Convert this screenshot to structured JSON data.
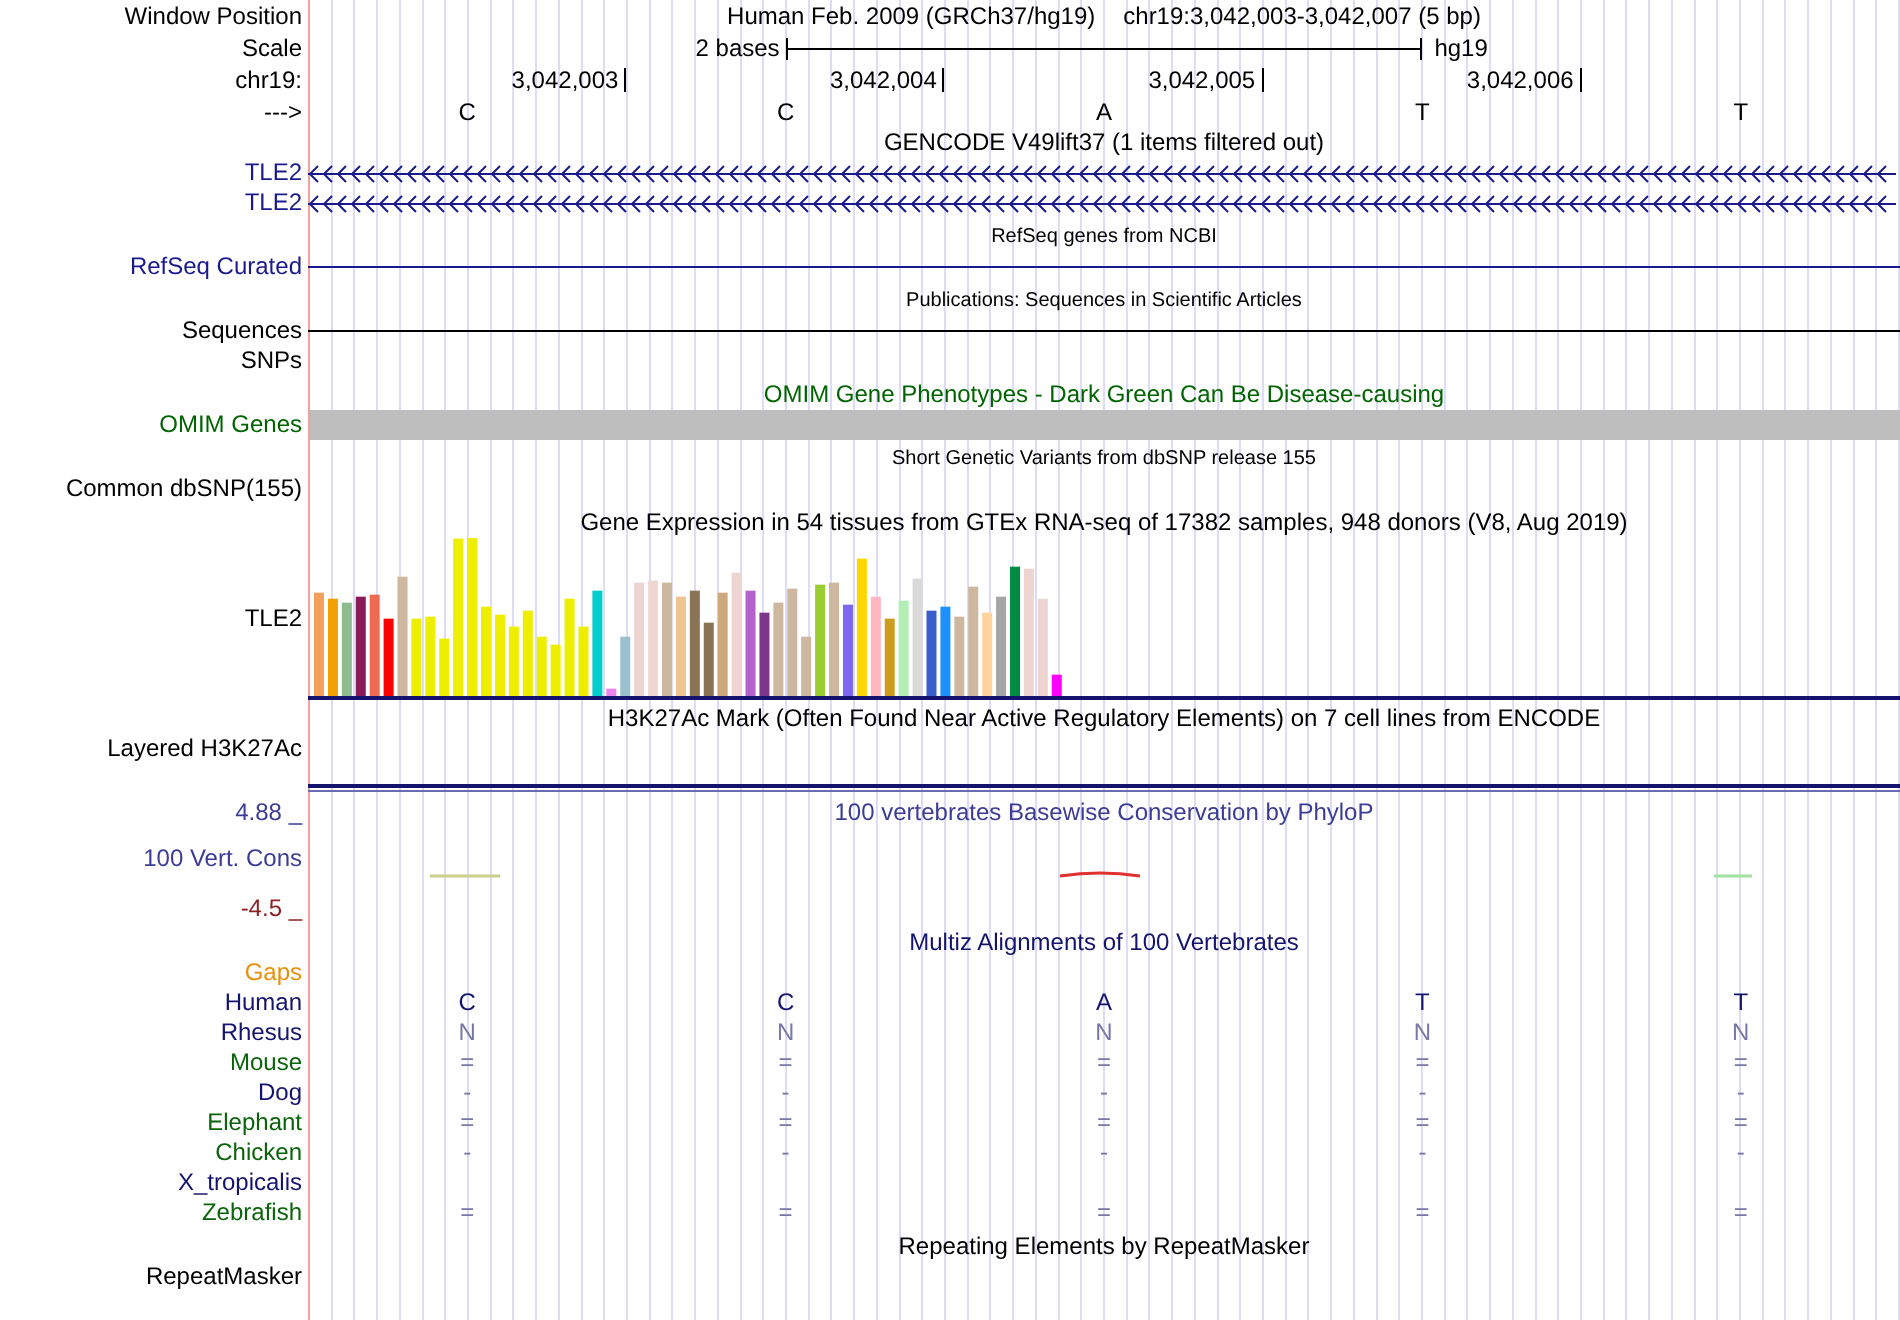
{
  "header": {
    "position_label": "Window Position",
    "assembly": "Human Feb. 2009 (GRCh37/hg19)",
    "position": "chr19:3,042,003-3,042,007 (5 bp)",
    "scale_label": "Scale",
    "scale_text": "2 bases",
    "scale_db": "hg19",
    "chrom_label": "chr19:",
    "ruler": [
      "3,042,003",
      "3,042,004",
      "3,042,005",
      "3,042,006"
    ],
    "strand_label": "--->",
    "bases": [
      "C",
      "C",
      "A",
      "T",
      "T"
    ]
  },
  "tracks": [
    {
      "kind": "major",
      "title": {
        "text": "GENCODE V49lift37 (1 items filtered out)",
        "color": "#000000"
      },
      "rows": [
        {
          "kind": "arrows",
          "label": "TLE2",
          "color": "#1a1a8c"
        },
        {
          "kind": "arrows",
          "label": "TLE2",
          "color": "#1a1a8c"
        }
      ]
    },
    {
      "kind": "minor",
      "title": {
        "text": "RefSeq genes from NCBI",
        "color": "#000000"
      },
      "rows": [
        {
          "kind": "line",
          "label": "RefSeq Curated",
          "color": "#1a1a8c"
        }
      ]
    },
    {
      "kind": "minor",
      "title": {
        "text": "Publications: Sequences in Scientific Articles",
        "color": "#000000"
      },
      "rows": [
        {
          "kind": "line",
          "label": "Sequences",
          "color": "#000000"
        },
        {
          "kind": "empty",
          "label": "SNPs",
          "color": "#000000"
        }
      ]
    },
    {
      "kind": "major",
      "title": {
        "text": "OMIM Gene Phenotypes - Dark Green Can Be Disease-causing",
        "color": "#006400"
      },
      "rows": [
        {
          "kind": "block",
          "label": "OMIM Genes",
          "color": "#006400"
        }
      ]
    },
    {
      "kind": "minor",
      "title": {
        "text": "Short Genetic Variants from dbSNP release 155",
        "color": "#000000"
      },
      "rows": [
        {
          "kind": "empty",
          "label": "Common dbSNP(155)",
          "color": "#000000"
        }
      ]
    },
    {
      "kind": "major",
      "title": {
        "text": "Gene Expression in 54 tissues from GTEx RNA-seq of 17382 samples, 948 donors (V8, Aug 2019)",
        "color": "#000000"
      },
      "rows": [
        {
          "kind": "expression",
          "label": "TLE2",
          "color": "#000000"
        }
      ]
    },
    {
      "kind": "major",
      "title": {
        "text": "H3K27Ac Mark (Often Found Near Active Regulatory Elements) on 7 cell lines from ENCODE",
        "color": "#000000"
      },
      "rows": [
        {
          "kind": "layered",
          "label": "Layered H3K27Ac",
          "color": "#000000"
        }
      ]
    },
    {
      "kind": "major",
      "title": {
        "text": "100 vertebrates Basewise Conservation by PhyloP",
        "color": "#3c3c96"
      },
      "max": {
        "text": "4.88 _",
        "color": "#3c3c96"
      },
      "rows": [
        {
          "kind": "signal",
          "label": "100 Vert. Cons",
          "color": "#3c3c96",
          "min": {
            "text": "-4.5 _",
            "color": "#8b2323"
          }
        }
      ]
    },
    {
      "kind": "major",
      "title": {
        "text": "Multiz Alignments of 100 Vertebrates",
        "color": "#14146e"
      },
      "rows": [
        {
          "kind": "empty",
          "label": "Gaps",
          "color": "#e8900c"
        },
        {
          "kind": "reference",
          "label": "Human",
          "color": "#14146e",
          "cells": [
            "C",
            "C",
            "A",
            "T",
            "T"
          ]
        },
        {
          "kind": "aligned",
          "label": "Rhesus",
          "color": "#14146e",
          "cells": [
            "N",
            "N",
            "N",
            "N",
            "N"
          ]
        },
        {
          "kind": "aligned",
          "label": "Mouse",
          "color": "#0a640a",
          "cells": [
            "=",
            "=",
            "=",
            "=",
            "="
          ]
        },
        {
          "kind": "aligned",
          "label": "Dog",
          "color": "#14146e",
          "cells": [
            "-",
            "-",
            "-",
            "-",
            "-"
          ]
        },
        {
          "kind": "aligned",
          "label": "Elephant",
          "color": "#0a640a",
          "cells": [
            "=",
            "=",
            "=",
            "=",
            "="
          ]
        },
        {
          "kind": "aligned",
          "label": "Chicken",
          "color": "#0a640a",
          "cells": [
            "-",
            "-",
            "-",
            "-",
            "-"
          ]
        },
        {
          "kind": "empty",
          "label": "X_tropicalis",
          "color": "#14146e"
        },
        {
          "kind": "aligned",
          "label": "Zebrafish",
          "color": "#0a640a",
          "cells": [
            "=",
            "=",
            "=",
            "=",
            "="
          ]
        }
      ]
    },
    {
      "kind": "major",
      "title": {
        "text": "Repeating Elements by RepeatMasker",
        "color": "#000000"
      },
      "rows": [
        {
          "kind": "empty",
          "label": "RepeatMasker",
          "color": "#000000"
        }
      ]
    }
  ]
}
